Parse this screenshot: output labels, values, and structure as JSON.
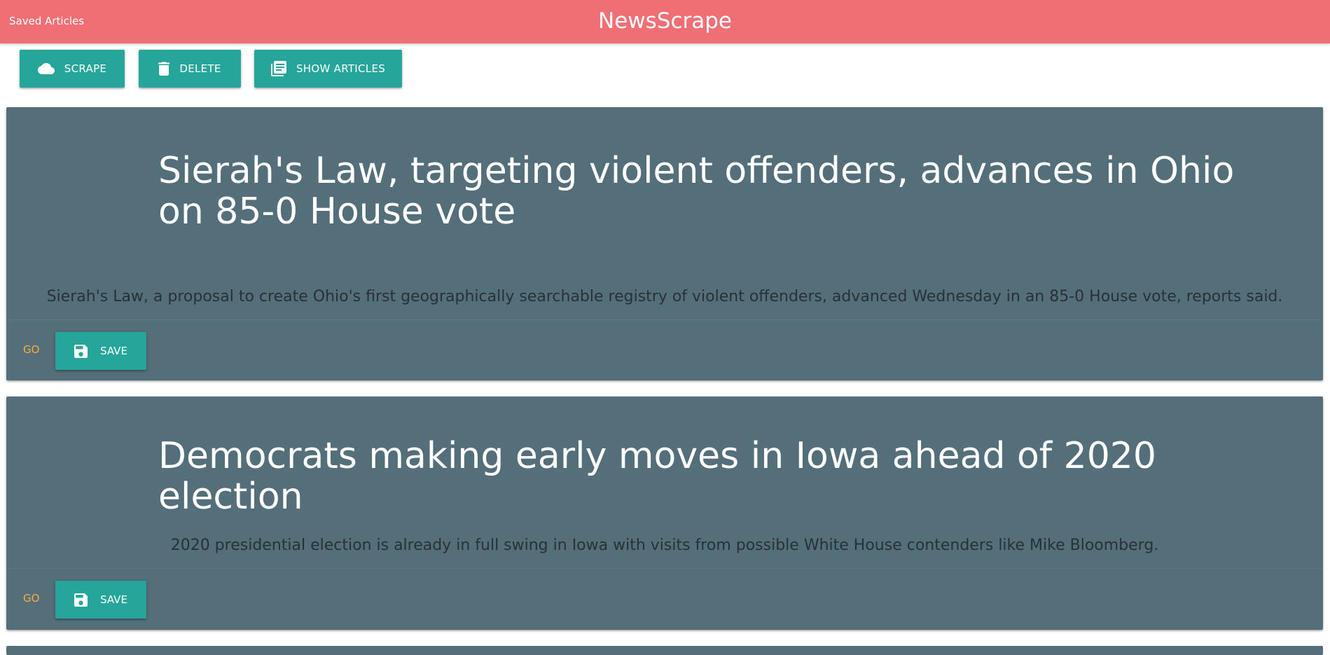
{
  "navbar": {
    "link_label": "Saved Articles",
    "brand": "NewsScrape",
    "bg_color": "#f06f75"
  },
  "toolbar": {
    "scrape_label": "SCRAPE",
    "scrape_icon": "cloud-icon",
    "delete_label": "DELETE",
    "delete_icon": "trash-icon",
    "show_label": "SHOW ARTICLES",
    "show_icon": "library-books-icon",
    "button_color": "#26a69a"
  },
  "articles": [
    {
      "title": "Sierah's Law, targeting violent offenders, advances in Ohio on 85-0 House vote",
      "summary": "Sierah's Law, a proposal to create Ohio's first geographically searchable registry of violent offenders, advanced Wednesday in an 85-0 House vote, reports said.",
      "go_label": "GO",
      "save_label": "SAVE",
      "save_icon": "save-icon"
    },
    {
      "title": "Democrats making early moves in Iowa ahead of 2020 election",
      "summary": "2020 presidential election is already in full swing in Iowa with visits from possible White House contenders like Mike Bloomberg.",
      "go_label": "GO",
      "save_label": "SAVE",
      "save_icon": "save-icon"
    }
  ],
  "colors": {
    "card_bg": "#546e7a",
    "go_link": "#ffab40"
  }
}
